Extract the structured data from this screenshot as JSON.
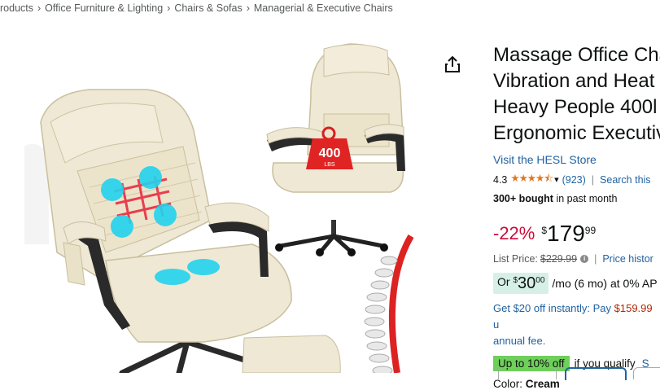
{
  "breadcrumb": {
    "items": [
      "roducts",
      "Office Furniture & Lighting",
      "Chairs & Sofas",
      "Managerial & Executive Chairs"
    ],
    "separator": "›"
  },
  "image": {
    "badge_weight": "400",
    "badge_unit": "LBS"
  },
  "product": {
    "title_lines": [
      "Massage Office Cha",
      "Vibration and Heat",
      "Heavy People 400l",
      "Ergonomic Executiv"
    ],
    "store_link": "Visit the HESL Store",
    "rating": "4.3",
    "stars": "★★★★⯪",
    "rating_count": "(923)",
    "search_link": "Search this",
    "bought_bold": "300+ bought",
    "bought_rest": " in past month",
    "discount": "-22%",
    "currency": "$",
    "price_whole": "179",
    "price_frac": "99",
    "list_price_label": "List Price:",
    "list_price": "$229.99",
    "price_history_link": "Price histor",
    "monthly_or": "Or",
    "monthly_sup": "$",
    "monthly_amount": "30",
    "monthly_cents": "00",
    "monthly_rest": "/mo (6 mo) at 0% AP",
    "instant_text": "Get $20 off instantly: Pay ",
    "instant_price": "$159.99",
    "instant_after": " u",
    "instant_line2": "annual fee.",
    "qualify_badge": "Up to 10% off",
    "qualify_text": "if you qualify",
    "qualify_link": "S",
    "color_label": "Color:",
    "color_value": "Cream"
  },
  "colors": {
    "link": "#2162a1",
    "discount": "#cc0c39",
    "star": "#de7921",
    "badge_green": "#6fcf5b",
    "monthly_bg": "#d6f0e8",
    "cream": "#efe8d4"
  }
}
